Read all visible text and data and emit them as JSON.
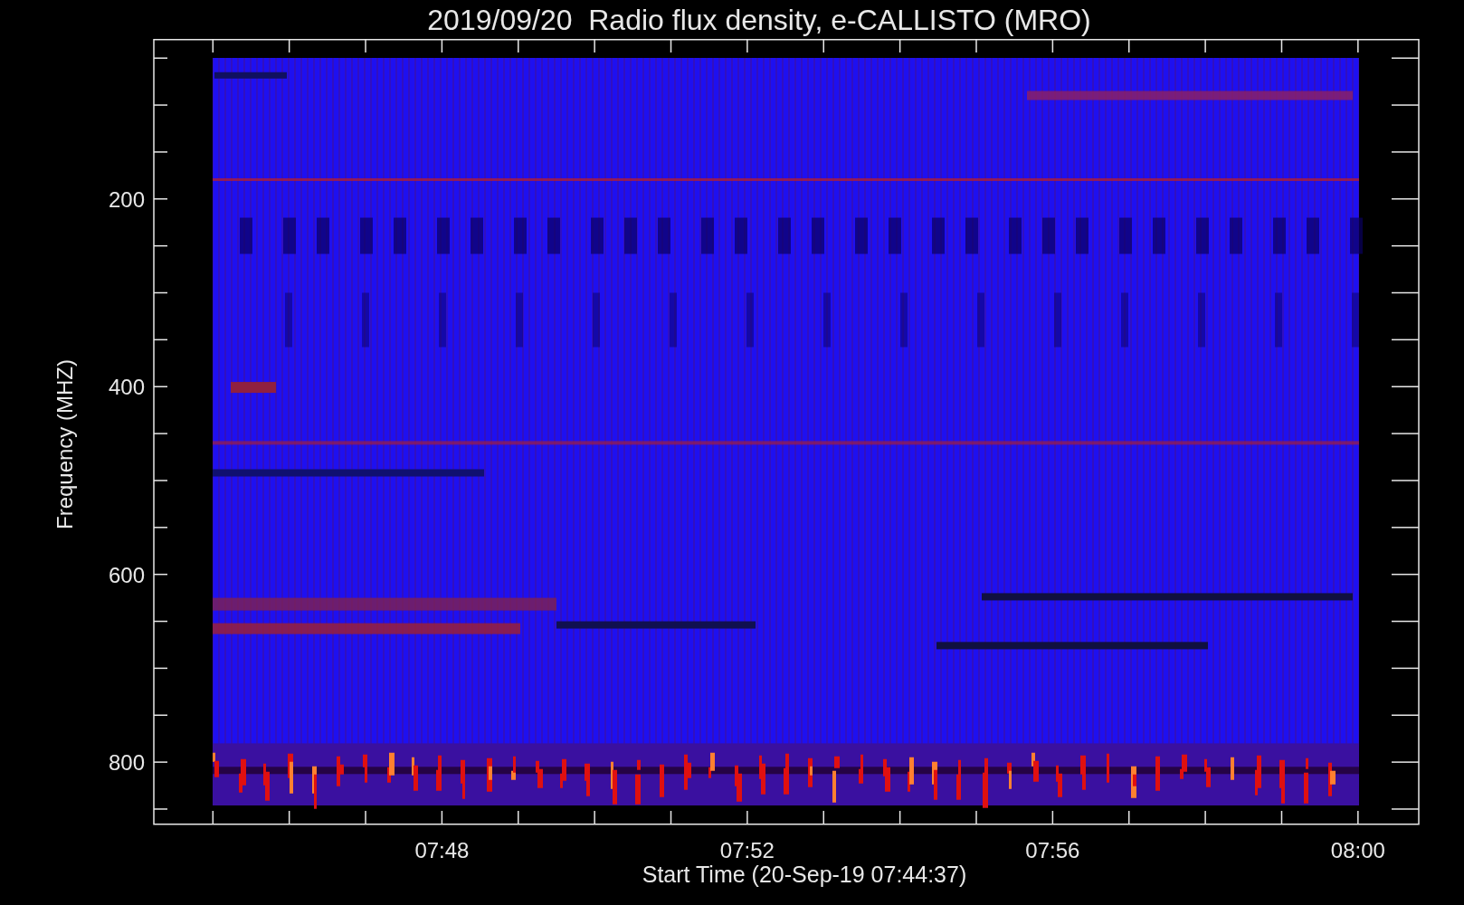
{
  "title": "2019/09/20  Radio flux density, e-CALLISTO (MRO)",
  "y_axis": {
    "label": "Frequency (MHZ)",
    "tick_labels": [
      "200",
      "400",
      "600",
      "800"
    ]
  },
  "x_axis": {
    "label": "Start Time (20-Sep-19 07:44:37)",
    "tick_labels": [
      "07:48",
      "07:52",
      "07:56",
      "08:00"
    ]
  }
}
